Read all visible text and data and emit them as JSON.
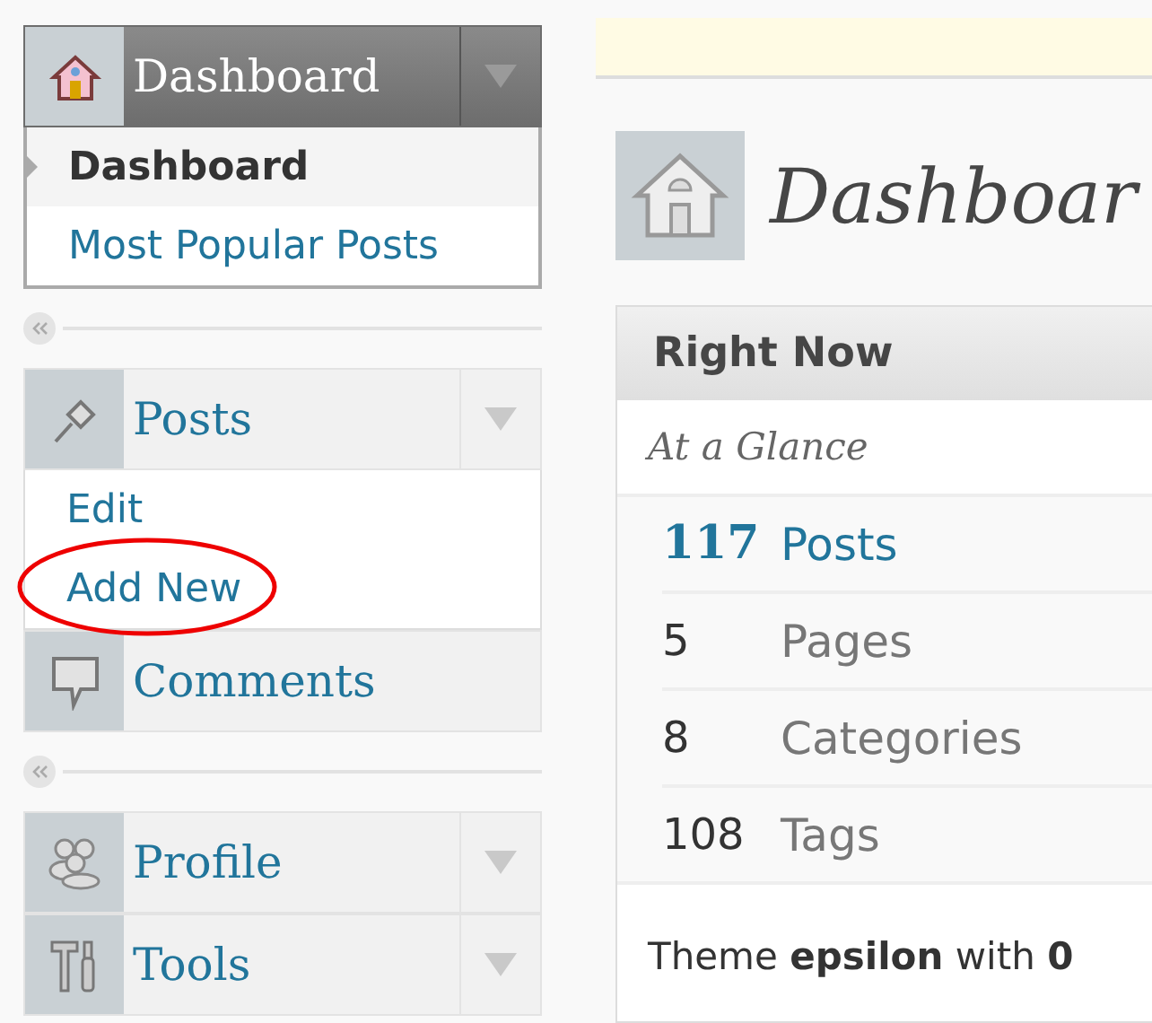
{
  "sidebar": {
    "menus": [
      {
        "label": "Dashboard",
        "current": true,
        "expanded": true,
        "toggle": true,
        "group_end": true,
        "submenu": [
          {
            "label": "Dashboard",
            "selected": true,
            "circled": false
          },
          {
            "label": "Most Popular Posts",
            "selected": false,
            "circled": false
          }
        ]
      },
      {
        "label": "Posts",
        "current": false,
        "expanded": true,
        "toggle": true,
        "group_end": false,
        "submenu": [
          {
            "label": "Edit",
            "selected": false,
            "circled": false
          },
          {
            "label": "Add New",
            "selected": false,
            "circled": true
          }
        ]
      },
      {
        "label": "Comments",
        "current": false,
        "toggle": false,
        "group_end": true
      },
      {
        "label": "Profile",
        "current": false,
        "toggle": true,
        "group_end": false
      },
      {
        "label": "Tools",
        "current": false,
        "toggle": true,
        "group_end": false
      }
    ]
  },
  "page_title": "Dashboar",
  "right_now": {
    "title": "Right Now",
    "subtitle": "At a Glance",
    "rows": [
      {
        "count": "117",
        "label": "Posts",
        "highlight": true
      },
      {
        "count": "5",
        "label": "Pages",
        "highlight": false
      },
      {
        "count": "8",
        "label": "Categories",
        "highlight": false
      },
      {
        "count": "108",
        "label": "Tags",
        "highlight": false
      }
    ],
    "theme_line": "Theme **epsilon** with **0**"
  }
}
